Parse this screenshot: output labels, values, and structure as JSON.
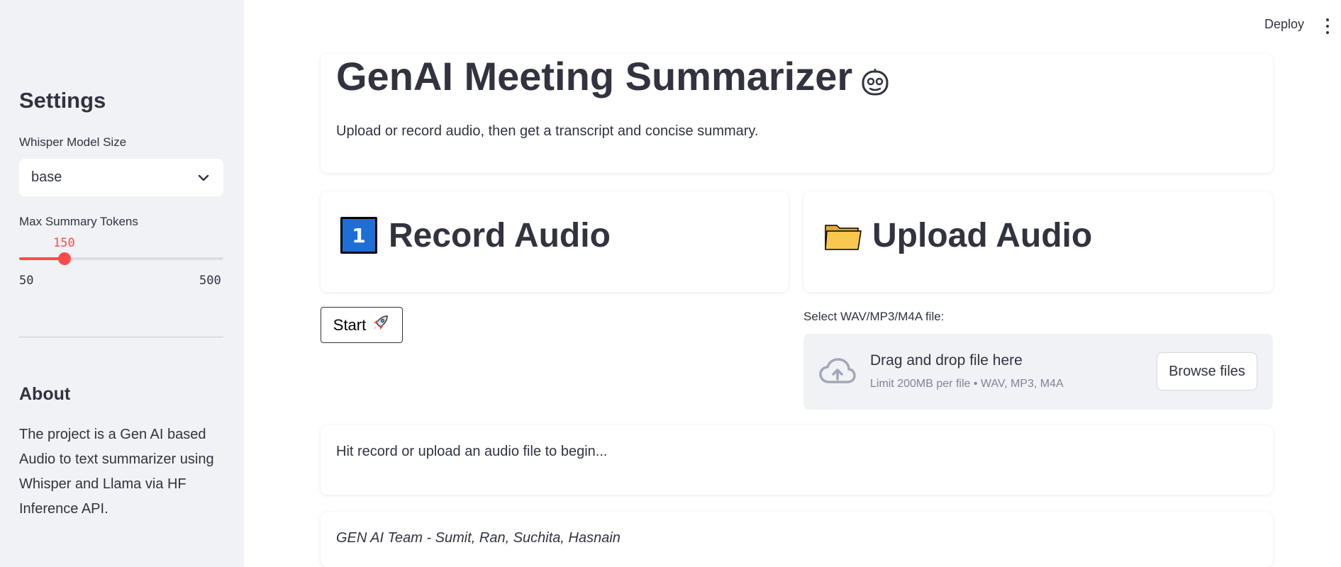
{
  "header": {
    "deploy_label": "Deploy"
  },
  "sidebar": {
    "title": "Settings",
    "model_size": {
      "label": "Whisper Model Size",
      "selected": "base"
    },
    "max_tokens": {
      "label": "Max Summary Tokens",
      "value": "150",
      "min": "50",
      "max": "500",
      "value_num": 150,
      "min_num": 50,
      "max_num": 500
    },
    "about": {
      "title": "About",
      "text": "The project is a Gen AI based Audio to text summarizer using Whisper and Llama via HF Inference API."
    }
  },
  "main": {
    "title": "GenAI Meeting Summarizer",
    "subtitle": "Upload or record audio, then get a transcript and concise summary.",
    "record": {
      "title": "Record Audio",
      "icon": "keycap-1-icon",
      "start_label": "Start",
      "start_icon": "rocket-icon"
    },
    "upload": {
      "title": "Upload Audio",
      "icon": "folder-icon",
      "file_label": "Select WAV/MP3/M4A file:",
      "drop_text": "Drag and drop file here",
      "limit_text": "Limit 200MB per file • WAV, MP3, M4A",
      "browse_label": "Browse files"
    },
    "info_message": "Hit record or upload an audio file to begin...",
    "team_credit": "GEN AI Team - Sumit, Ran, Suchita, Hasnain"
  },
  "colors": {
    "accent": "#ff4b4b",
    "sidebar_bg": "#f0f2f6",
    "text": "#31333f",
    "keycap_blue": "#1d6fd6",
    "folder_yellow": "#f9c74f"
  }
}
